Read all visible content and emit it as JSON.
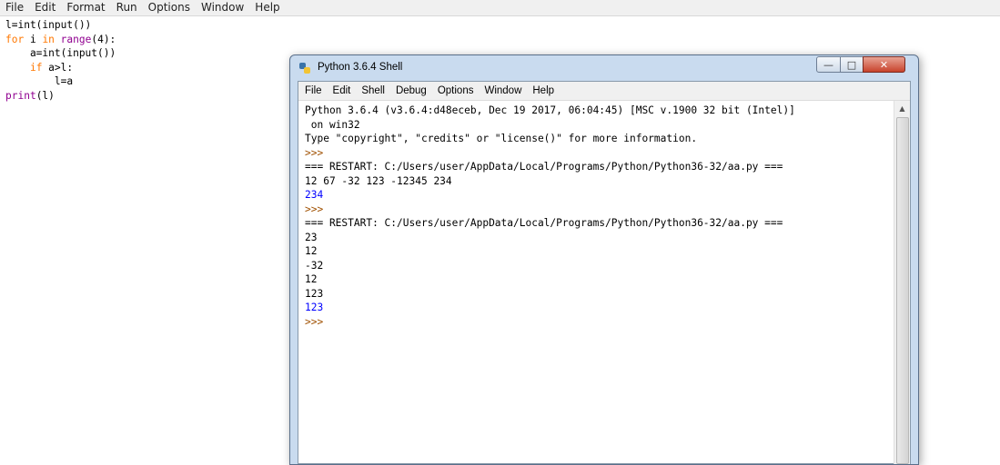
{
  "editor": {
    "menu": [
      "File",
      "Edit",
      "Format",
      "Run",
      "Options",
      "Window",
      "Help"
    ],
    "code_lines": [
      {
        "tokens": [
          {
            "t": "l=int(input())",
            "c": "plain"
          }
        ]
      },
      {
        "tokens": [
          {
            "t": "for",
            "c": "kw"
          },
          {
            "t": " i ",
            "c": "plain"
          },
          {
            "t": "in",
            "c": "kw"
          },
          {
            "t": " range",
            "c": "bi"
          },
          {
            "t": "(4):",
            "c": "plain"
          }
        ]
      },
      {
        "tokens": [
          {
            "t": "    a=int(input())",
            "c": "plain"
          }
        ]
      },
      {
        "tokens": [
          {
            "t": "    ",
            "c": "plain"
          },
          {
            "t": "if",
            "c": "kw"
          },
          {
            "t": " a>l:",
            "c": "plain"
          }
        ]
      },
      {
        "tokens": [
          {
            "t": "        l=a",
            "c": "plain"
          }
        ]
      },
      {
        "tokens": [
          {
            "t": "print",
            "c": "bi"
          },
          {
            "t": "(l)",
            "c": "plain"
          }
        ]
      }
    ]
  },
  "shell": {
    "title": "Python 3.6.4 Shell",
    "controls": {
      "minimize": "—",
      "maximize": "□",
      "close": "✕"
    },
    "menu": [
      "File",
      "Edit",
      "Shell",
      "Debug",
      "Options",
      "Window",
      "Help"
    ],
    "lines": [
      {
        "text": "Python 3.6.4 (v3.6.4:d48eceb, Dec 19 2017, 06:04:45) [MSC v.1900 32 bit (Intel)]",
        "style": "plain"
      },
      {
        "text": " on win32",
        "style": "plain"
      },
      {
        "text": "Type \"copyright\", \"credits\" or \"license()\" for more information.",
        "style": "plain"
      },
      {
        "text": ">>>",
        "style": "prompt"
      },
      {
        "text": "=== RESTART: C:/Users/user/AppData/Local/Programs/Python/Python36-32/aa.py ===",
        "style": "plain"
      },
      {
        "text": "12 67 -32 123 -12345 234",
        "style": "plain"
      },
      {
        "text": "234",
        "style": "blue"
      },
      {
        "text": ">>>",
        "style": "prompt"
      },
      {
        "text": "=== RESTART: C:/Users/user/AppData/Local/Programs/Python/Python36-32/aa.py ===",
        "style": "plain"
      },
      {
        "text": "23",
        "style": "plain"
      },
      {
        "text": "12",
        "style": "plain"
      },
      {
        "text": "-32",
        "style": "plain"
      },
      {
        "text": "12",
        "style": "plain"
      },
      {
        "text": "123",
        "style": "plain"
      },
      {
        "text": "123",
        "style": "blue"
      },
      {
        "text": ">>>",
        "style": "prompt"
      }
    ]
  },
  "colors": {
    "keyword": "#ff7700",
    "builtin": "#900090",
    "output": "#0000ff",
    "prompt": "#a05000"
  }
}
